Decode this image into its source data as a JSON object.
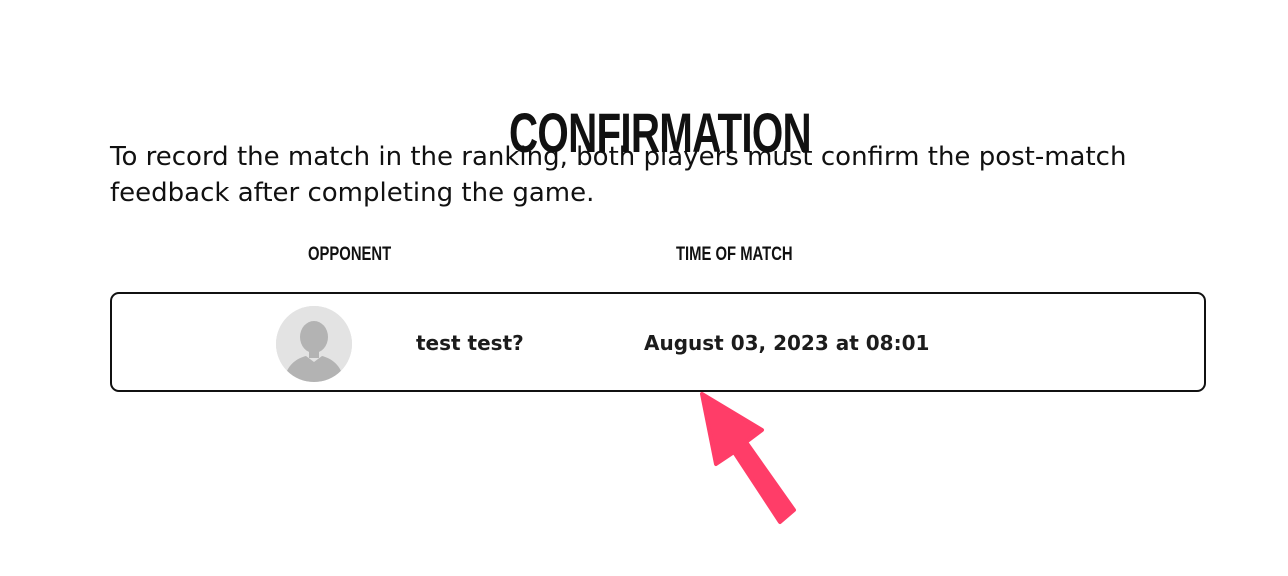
{
  "page": {
    "title": "CONFIRMATION",
    "intro": "To record the match in the ranking, both players must confirm the post-match feedback after completing the game."
  },
  "table": {
    "headers": {
      "opponent": "OPPONENT",
      "time": "TIME OF MATCH"
    },
    "rows": [
      {
        "avatar_icon": "default-user-avatar-icon",
        "opponent": "test test?",
        "time": "August 03, 2023 at 08:01"
      }
    ]
  },
  "annotation": {
    "icon": "arrow-pointer-icon",
    "color": "#ff3d68"
  },
  "colors": {
    "text": "#111111",
    "card_border": "#111111",
    "avatar_bg": "#e3e3e3",
    "avatar_silhouette": "#b3b3b3"
  }
}
